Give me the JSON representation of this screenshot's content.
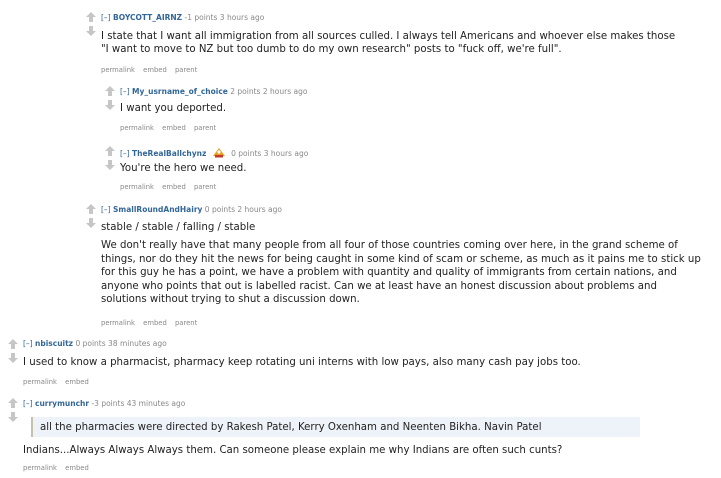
{
  "colors": {
    "author": "#336699",
    "meta": "#888888",
    "text": "#222222",
    "arrow": "#c6c6c6",
    "quote_bg": "#eef2f9",
    "quote_border": "#c5c1ad"
  },
  "comments": [
    {
      "expand": "[–]",
      "author": "BOYCOTT_AIRNZ",
      "score": "-1 points",
      "time": "3 hours ago",
      "body": [
        "I state that I want all immigration from all sources culled. I always tell Americans and whoever else makes those",
        "\"I want to move to NZ but too dumb to do my own research\" posts to \"fuck off, we're full\"."
      ],
      "actions": [
        "permalink",
        "embed",
        "parent"
      ]
    },
    {
      "expand": "[–]",
      "author": "My_usrname_of_choice",
      "score": "2 points",
      "time": "2 hours ago",
      "body": [
        "I want you deported."
      ],
      "actions": [
        "permalink",
        "embed",
        "parent"
      ]
    },
    {
      "expand": "[–]",
      "author": "TheRealBallchynz",
      "flair": "flair-badge-icon",
      "score": "0 points",
      "time": "3 hours ago",
      "body": [
        "You're the hero we need."
      ],
      "actions": [
        "permalink",
        "embed",
        "parent"
      ]
    },
    {
      "expand": "[–]",
      "author": "SmallRoundAndHairy",
      "score": "0 points",
      "time": "2 hours ago",
      "body": [
        "stable / stable / falling / stable",
        "We don't really have that many people from all four of those countries coming over here, in the grand scheme of things, nor do they hit the news for being caught in some kind of scam or scheme, as much as it pains me to stick up for this guy he has a point, we have a problem with quantity and quality of immigrants from certain nations, and anyone who points that out is labelled racist. Can we at least have an honest discussion about problems and solutions without trying to shut a discussion down."
      ],
      "actions": [
        "permalink",
        "embed",
        "parent"
      ]
    },
    {
      "expand": "[–]",
      "author": "nbiscuitz",
      "score": "0 points",
      "time": "38 minutes ago",
      "body": [
        "I used to know a pharmacist, pharmacy keep rotating uni interns with low pays, also many cash pay jobs too."
      ],
      "actions": [
        "permalink",
        "embed"
      ]
    },
    {
      "expand": "[–]",
      "author": "currymunchr",
      "score": "-3 points",
      "time": "43 minutes ago",
      "quote": "all the pharmacies were directed by Rakesh Patel, Kerry Oxenham and Neenten Bikha. Navin Patel",
      "body": [
        "Indians...Always Always Always them. Can someone please explain me why Indians are often such cunts?"
      ],
      "actions": [
        "permalink",
        "embed"
      ]
    }
  ]
}
